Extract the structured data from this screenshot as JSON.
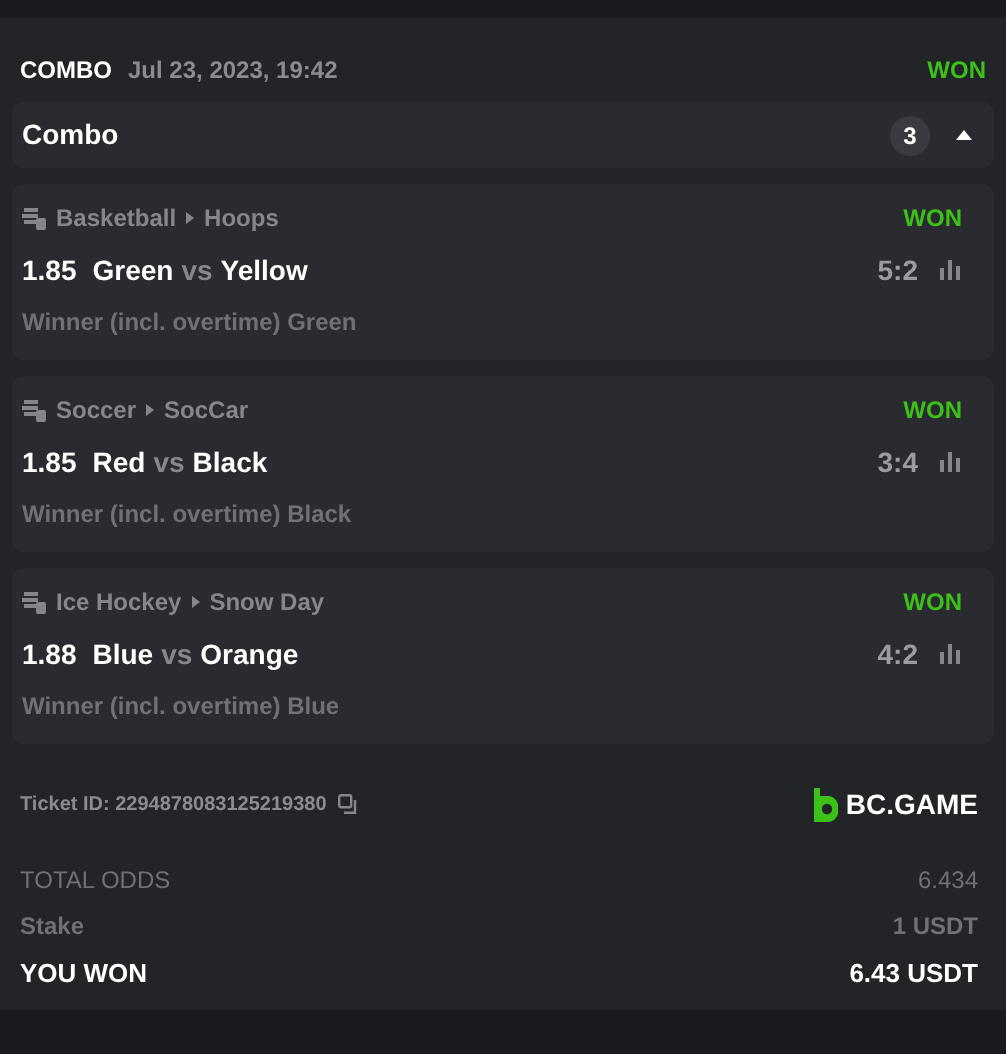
{
  "header": {
    "type_label": "COMBO",
    "datetime": "Jul 23, 2023, 19:42",
    "status": "WON"
  },
  "combo_bar": {
    "title": "Combo",
    "count": "3",
    "expanded": true
  },
  "legs": [
    {
      "sport": "Basketball",
      "league": "Hoops",
      "status": "WON",
      "odds": "1.85",
      "team_1": "Green",
      "vs": "vs",
      "team_2": "Yellow",
      "score": "5:2",
      "market": "Winner (incl. overtime) Green"
    },
    {
      "sport": "Soccer",
      "league": "SocCar",
      "status": "WON",
      "odds": "1.85",
      "team_1": "Red",
      "vs": "vs",
      "team_2": "Black",
      "score": "3:4",
      "market": "Winner (incl. overtime) Black"
    },
    {
      "sport": "Ice Hockey",
      "league": "Snow Day",
      "status": "WON",
      "odds": "1.88",
      "team_1": "Blue",
      "vs": "vs",
      "team_2": "Orange",
      "score": "4:2",
      "market": "Winner (incl. overtime) Blue"
    }
  ],
  "ticket": {
    "label": "Ticket ID: 2294878083125219380",
    "brand": "BC.GAME"
  },
  "totals": [
    {
      "kind": "muted",
      "label": "TOTAL ODDS",
      "value": "6.434"
    },
    {
      "kind": "stake",
      "label": "Stake",
      "value": "1 USDT"
    },
    {
      "kind": "win",
      "label": "YOU WON",
      "value": "6.43 USDT"
    }
  ]
}
